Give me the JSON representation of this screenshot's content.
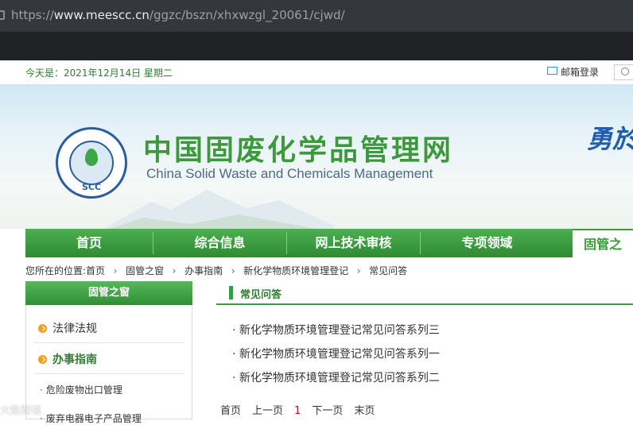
{
  "browser": {
    "url_prefix": "https://",
    "url_domain": "www.meescc.cn",
    "url_path": "/ggzc/bszn/xhxwzgl_20061/cjwd/"
  },
  "topbar": {
    "date_text": "今天是：2021年12月14日  星期二",
    "mail_login": "邮箱登录"
  },
  "banner": {
    "logo_text": "SCC",
    "title_cn": "中国固废化学品管理网",
    "title_en": "China Solid Waste and Chemicals Management",
    "slogan": "勇於"
  },
  "nav": {
    "items": [
      "首页",
      "综合信息",
      "网上技术审核",
      "专项领域",
      "固管之"
    ]
  },
  "breadcrumb": {
    "prefix": "您所在的位置:",
    "items": [
      "首页",
      "固管之窗",
      "办事指南",
      "新化学物质环境管理登记",
      "常见问答"
    ]
  },
  "sidebar": {
    "title": "固管之窗",
    "items": [
      "法律法规",
      "办事指南"
    ],
    "subitems": [
      "危险废物出口管理",
      "废弃电器电子产品管理"
    ]
  },
  "main": {
    "section_title": "常见问答",
    "articles": [
      "新化学物质环境管理登记常见问答系列三",
      "新化学物质环境管理登记常见问答系列一",
      "新化学物质环境管理登记常见问答系列二"
    ],
    "pager": {
      "first": "首页",
      "prev": "上一页",
      "current": "1",
      "next": "下一页",
      "last": "末页"
    }
  },
  "watermark": "大数跨境"
}
